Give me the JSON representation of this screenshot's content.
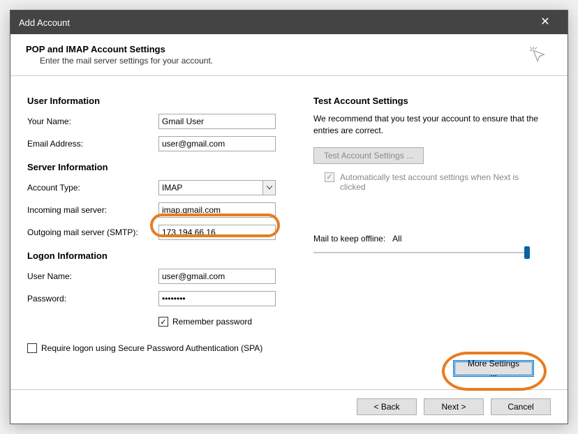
{
  "window": {
    "title": "Add Account"
  },
  "wizard": {
    "heading": "POP and IMAP Account Settings",
    "subheading": "Enter the mail server settings for your account."
  },
  "left": {
    "user_info_title": "User Information",
    "your_name_label": "Your Name:",
    "your_name_value": "Gmail User",
    "email_label": "Email Address:",
    "email_value": "user@gmail.com",
    "server_info_title": "Server Information",
    "account_type_label": "Account Type:",
    "account_type_value": "IMAP",
    "incoming_label": "Incoming mail server:",
    "incoming_value": "imap.gmail.com",
    "outgoing_label": "Outgoing mail server (SMTP):",
    "outgoing_value": "173.194.66.16",
    "logon_title": "Logon Information",
    "username_label": "User Name:",
    "username_value": "user@gmail.com",
    "password_label": "Password:",
    "password_value": "********",
    "remember_password": "Remember password",
    "spa_label": "Require logon using Secure Password Authentication (SPA)"
  },
  "right": {
    "test_title": "Test Account Settings",
    "test_desc": "We recommend that you test your account to ensure that the entries are correct.",
    "test_btn": "Test Account Settings ...",
    "auto_test": "Automatically test account settings when Next is clicked",
    "mail_offline_label": "Mail to keep offline:",
    "mail_offline_value": "All",
    "more_settings": "More Settings ..."
  },
  "footer": {
    "back": "< Back",
    "next": "Next >",
    "cancel": "Cancel"
  }
}
